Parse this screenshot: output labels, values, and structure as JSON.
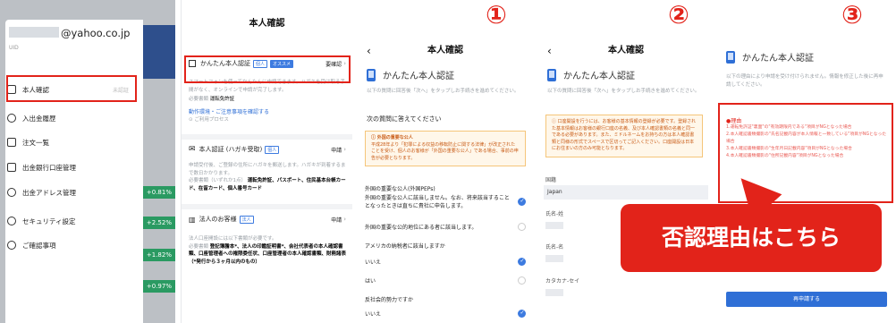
{
  "panel1": {
    "email": "@yahoo.co.jp",
    "uid": "UID",
    "menu": [
      {
        "label": "本人確認",
        "sub": "未認証"
      },
      {
        "label": "入出金履歴",
        "sub": ""
      },
      {
        "label": "注文一覧",
        "sub": ""
      },
      {
        "label": "出金銀行口座管理",
        "sub": ""
      },
      {
        "label": "出金アドレス管理",
        "sub": ""
      },
      {
        "label": "セキュリティ設定",
        "sub": ""
      },
      {
        "label": "ご確認事項",
        "sub": ""
      }
    ],
    "badges": [
      "+0.81%",
      "+2.52%",
      "+1.82%",
      "+0.97%"
    ]
  },
  "panel2": {
    "title": "本人確認",
    "easy": {
      "label": "かんたん本人認証",
      "tag1": "個人",
      "tag2": "オススメ",
      "status": "要確認",
      "desc": "スマートフォンを使ってかんたんに申請できます。ハガキを受け取る手間がなく、オンラインで申請が完了します。",
      "req_label": "必要書類",
      "req": "運転免許証",
      "link1": "動作環境・ご注意事項を確認する",
      "link2": "ご利用プロセス"
    },
    "postcard": {
      "label": "本人認証 (ハガキ受取)",
      "tag": "個人",
      "status": "申請",
      "desc": "申請受付後、ご登録の住所にハガキを郵送します。ハガキが到着するまで数日かかります。",
      "req_label": "必要書類（いずれか1点）",
      "req": "運転免許証、パスポート、住民基本台帳カード、在留カード、個人番号カード"
    },
    "corp": {
      "label": "法人のお客様",
      "tag": "法人",
      "status": "申請",
      "desc": "法人口座開設には以下書類が必要です。",
      "req_label": "必要書類",
      "req": "登記簿謄本*、法人の印鑑証明書*、会社代表者の本人確認書類、口座管理者への権限委任状、口座管理者の本人確認書類、財務諸表（*発行から３ヶ月以内のもの）"
    }
  },
  "panel3": {
    "marker": "①",
    "title": "本人確認",
    "heading": "かんたん本人認証",
    "intro": "以下の質問に回答後「次へ」をタップしお手続きを進めてください。",
    "question": "次の質問に答えてください",
    "alert_title": "外国の重要な公人",
    "alert_body": "平成28年より「犯罪による収益の移転防止に関する法律」が改正されたことを受け、個人のお客様が「外国の重要な公人」である場合、事前の申告が必要となります。",
    "peps_label": "外国の重要な公人(外国PEPs)",
    "opt1": "外国の重要な公人に該当しません。なお、将来該当することとなったときは直ちに貴社に申告します。",
    "opt2": "外国の重要な公的地位にある者に該当します。",
    "us_label": "アメリカの納税者に該当しますか",
    "no": "いいえ",
    "yes": "はい",
    "anti_label": "反社会的勢力ですか",
    "anti_no": "いいえ"
  },
  "panel4": {
    "marker": "②",
    "title": "本人確認",
    "heading": "かんたん本人認証",
    "intro": "以下の質問に回答後「次へ」をタップしお手続きを進めてください。",
    "alert": "口座開設を行うには、お客様の基本情報の登録が必要です。登録された基本情報はお客様の銀行口座の名義、及び本人確認書類の名義と同一である必要があります。また、ミドルネームをお持ちの方は本人確認書類と同様の形式でスペースで区切ってご記入ください。口座開設は日本にお住まいの方のみ可能となります。",
    "country_label": "国籍",
    "country": "Japan",
    "sei_label": "氏名-姓",
    "mei_label": "氏名-名",
    "kana_label": "カタカナ-セイ"
  },
  "panel5": {
    "marker": "③",
    "heading": "かんたん本人認証",
    "intro": "以下の理由により申請を受け付けられません。情報を修正した後に再申請してください。",
    "warn_title": "●理由",
    "warn_lines": [
      "1.運転免許証\"裏面\"の\"有効期限内である\"項目がNGとなった場合",
      "2.本人確認書類撮影の\"氏名記載内容が本人情報と一致している\"項目がNGとなった場合",
      "3.本人確認書類撮影の\"生年月日記載内容\"項目がNGとなった場合",
      "4.本人確認書類撮影の\"住所記載内容\"項目がNGとなった場合"
    ],
    "reapply": "再申請する"
  },
  "callout": "否認理由はこちら"
}
